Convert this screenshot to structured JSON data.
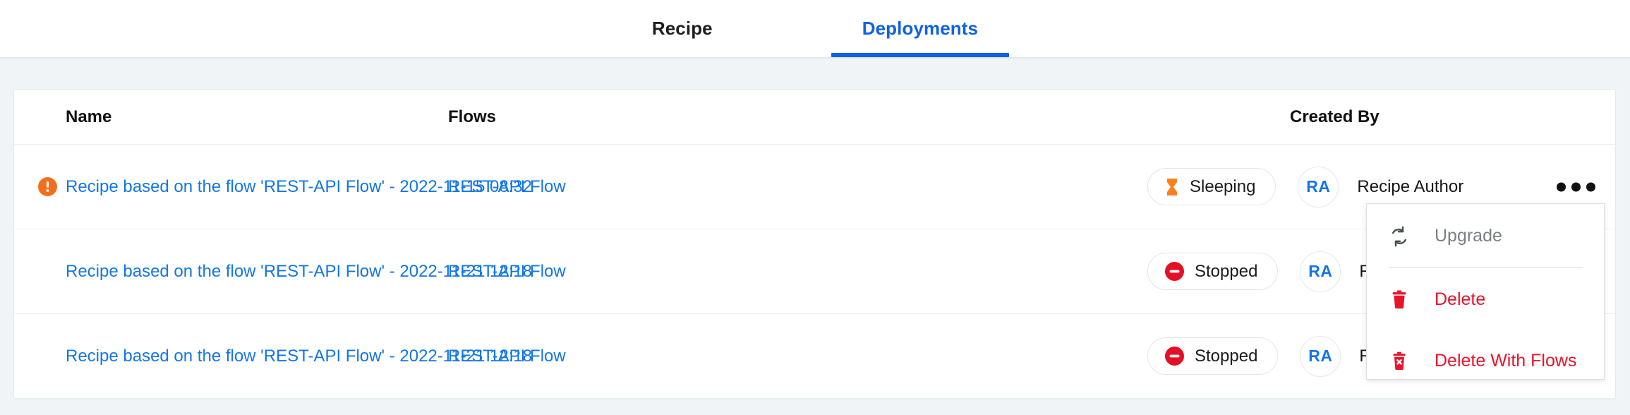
{
  "tabs": [
    {
      "label": "Recipe",
      "active": false
    },
    {
      "label": "Deployments",
      "active": true
    }
  ],
  "table": {
    "headers": {
      "name": "Name",
      "flows": "Flows",
      "created_by": "Created By"
    },
    "rows": [
      {
        "warning": true,
        "warning_icon": "warning-exclamation-icon",
        "name": "Recipe based on the flow 'REST-API Flow' - 2022-11-15 08:32",
        "flow": "REST-API Flow",
        "status": "Sleeping",
        "status_icon": "hourglass-icon",
        "avatar_initials": "RA",
        "created_by": "Recipe Author"
      },
      {
        "warning": false,
        "warning_icon": "",
        "name": "Recipe based on the flow 'REST-API Flow' - 2022-11-21 12:18",
        "flow": "REST-API Flow",
        "status": "Stopped",
        "status_icon": "stop-circle-icon",
        "avatar_initials": "RA",
        "created_by": "Recip"
      },
      {
        "warning": false,
        "warning_icon": "",
        "name": "Recipe based on the flow 'REST-API Flow' - 2022-11-21 12:18",
        "flow": "REST-API Flow",
        "status": "Stopped",
        "status_icon": "stop-circle-icon",
        "avatar_initials": "RA",
        "created_by": "Recip"
      }
    ]
  },
  "row_menu": {
    "items": [
      {
        "label": "Upgrade",
        "icon": "sync-refresh-icon",
        "disabled": true
      },
      {
        "label": "Delete",
        "icon": "trash-icon",
        "disabled": false
      },
      {
        "label": "Delete With Flows",
        "icon": "trash-x-icon",
        "disabled": false
      }
    ]
  },
  "colors": {
    "accent_blue": "#0f62e6",
    "link_blue": "#1276e8",
    "warning_orange": "#f2701d",
    "danger_red": "#e8142b",
    "page_bg": "#f1f4f7"
  }
}
